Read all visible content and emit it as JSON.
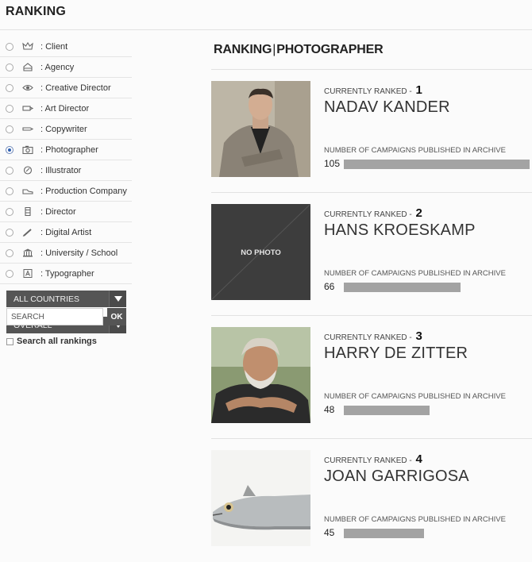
{
  "page": {
    "title": "RANKING"
  },
  "sidebar": {
    "roles": [
      {
        "label": ": Client",
        "icon": "crown-icon",
        "checked": false
      },
      {
        "label": ": Agency",
        "icon": "house-icon",
        "checked": false
      },
      {
        "label": ": Creative Director",
        "icon": "eye-icon",
        "checked": false
      },
      {
        "label": ": Art Director",
        "icon": "marker-icon",
        "checked": false
      },
      {
        "label": ": Copywriter",
        "icon": "pen-icon",
        "checked": false
      },
      {
        "label": ": Photographer",
        "icon": "camera-icon",
        "checked": true
      },
      {
        "label": ": Illustrator",
        "icon": "palette-icon",
        "checked": false
      },
      {
        "label": ": Production Company",
        "icon": "shoe-icon",
        "checked": false
      },
      {
        "label": ": Director",
        "icon": "film-icon",
        "checked": false
      },
      {
        "label": ": Digital Artist",
        "icon": "stylus-icon",
        "checked": false
      },
      {
        "label": ": University / School",
        "icon": "building-icon",
        "checked": false
      },
      {
        "label": ": Typographer",
        "icon": "letter-a-icon",
        "checked": false
      }
    ],
    "country_select": "ALL COUNTRIES",
    "period_select": "OVERALL",
    "search": {
      "placeholder": "SEARCH",
      "value": ""
    },
    "ok_label": "OK",
    "search_all_label": "Search all rankings"
  },
  "main": {
    "title_left": "RANKING",
    "title_sep": "|",
    "title_right": "PHOTOGRAPHER",
    "rank_label": "CURRENTLY RANKED -",
    "campaigns_label": "NUMBER OF CAMPAIGNS PUBLISHED IN ARCHIVE",
    "no_photo_label": "NO PHOTO",
    "entries": [
      {
        "rank": "1",
        "name": "NADAV KANDER",
        "campaigns": "105",
        "bar_fraction": 1.0,
        "photo": "portrait-suit"
      },
      {
        "rank": "2",
        "name": "HANS KROESKAMP",
        "campaigns": "66",
        "bar_fraction": 0.63,
        "photo": "none"
      },
      {
        "rank": "3",
        "name": "HARRY DE ZITTER",
        "campaigns": "48",
        "bar_fraction": 0.46,
        "photo": "portrait-beard"
      },
      {
        "rank": "4",
        "name": "JOAN GARRIGOSA",
        "campaigns": "45",
        "bar_fraction": 0.43,
        "photo": "fish"
      }
    ]
  },
  "colors": {
    "dropdown": "#555555",
    "bar": "#a3a3a3",
    "radio_checked": "#2d5fb0"
  }
}
